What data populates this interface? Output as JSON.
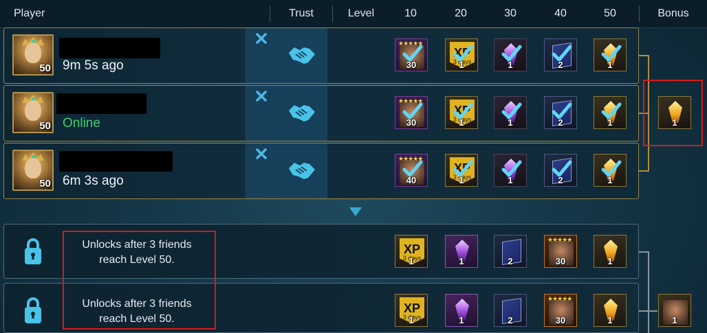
{
  "header": {
    "player": "Player",
    "trust": "Trust",
    "level": "Level",
    "l10": "10",
    "l20": "20",
    "l30": "30",
    "l40": "40",
    "l50": "50",
    "bonus": "Bonus"
  },
  "friends": [
    {
      "avatar_level": "50",
      "status": "9m 5s ago",
      "rewards": [
        {
          "type": "hero-card",
          "count": "30"
        },
        {
          "type": "xp-booster",
          "label": "XP",
          "days": "3 days",
          "count": "1"
        },
        {
          "type": "crystal",
          "count": "1"
        },
        {
          "type": "tome",
          "count": "2"
        },
        {
          "type": "crystal-gold",
          "count": "1"
        }
      ]
    },
    {
      "avatar_level": "50",
      "status": "Online",
      "rewards": [
        {
          "type": "hero-card",
          "count": "30"
        },
        {
          "type": "xp-booster",
          "label": "XP",
          "days": "3 days",
          "count": "1"
        },
        {
          "type": "crystal",
          "count": "1"
        },
        {
          "type": "tome",
          "count": "2"
        },
        {
          "type": "crystal-gold",
          "count": "1"
        }
      ]
    },
    {
      "avatar_level": "50",
      "status": "6m 3s ago",
      "rewards": [
        {
          "type": "hero-card",
          "count": "40"
        },
        {
          "type": "xp-booster",
          "label": "XP",
          "days": "3 days",
          "count": "1"
        },
        {
          "type": "crystal",
          "count": "1"
        },
        {
          "type": "tome",
          "count": "2"
        },
        {
          "type": "crystal-gold",
          "count": "1"
        }
      ]
    }
  ],
  "bonus_top": {
    "count": "1"
  },
  "locked": [
    {
      "text_line1": "Unlocks after 3 friends",
      "text_line2": "reach Level 50.",
      "rewards": [
        {
          "type": "xp-booster",
          "label": "XP",
          "days": "3 days",
          "count": "1"
        },
        {
          "type": "crystal",
          "count": "1"
        },
        {
          "type": "tome",
          "count": "2"
        },
        {
          "type": "hero-card",
          "count": "30"
        },
        {
          "type": "crystal-gold",
          "count": "1"
        }
      ]
    },
    {
      "text_line1": "Unlocks after 3 friends",
      "text_line2": "reach Level 50.",
      "rewards": [
        {
          "type": "xp-booster",
          "label": "XP",
          "days": "3 days",
          "count": "1"
        },
        {
          "type": "crystal",
          "count": "1"
        },
        {
          "type": "tome",
          "count": "2"
        },
        {
          "type": "hero-card",
          "count": "30"
        },
        {
          "type": "crystal-gold",
          "count": "1"
        }
      ]
    }
  ],
  "bonus_bottom": {
    "count": "1"
  },
  "colors": {
    "accent": "#3fc3e8",
    "gold_border": "#9b8646",
    "online": "#3bd06b",
    "highlight": "#d81a1a"
  }
}
